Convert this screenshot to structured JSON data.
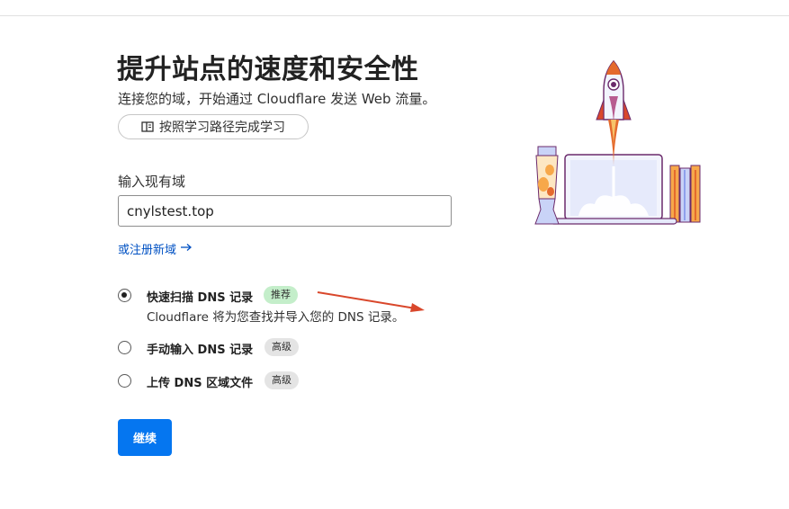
{
  "header": {
    "title": "提升站点的速度和安全性",
    "subtitle": "连接您的域，开始通过 Cloudflare 发送 Web 流量。",
    "learn_button": "按照学习路径完成学习"
  },
  "domain_form": {
    "label": "输入现有域",
    "value": "cnylstest.top",
    "register_link": "或注册新域"
  },
  "dns_options": [
    {
      "label": "快速扫描 DNS 记录",
      "badge": "推荐",
      "description": "Cloudflare 将为您查找并导入您的 DNS 记录。",
      "selected": true
    },
    {
      "label": "手动输入 DNS 记录",
      "badge": "高级",
      "selected": false
    },
    {
      "label": "上传 DNS 区域文件",
      "badge": "高级",
      "selected": false
    }
  ],
  "continue_button": "继续",
  "colors": {
    "primary_button": "#0576f0",
    "link": "#0051c3",
    "recommended_badge": "#c4eeca",
    "advanced_badge": "#e4e4e4",
    "annotation_arrow": "#d9472b"
  },
  "icons": [
    "book-icon",
    "arrow-right-icon",
    "rocket-launch-illustration"
  ]
}
